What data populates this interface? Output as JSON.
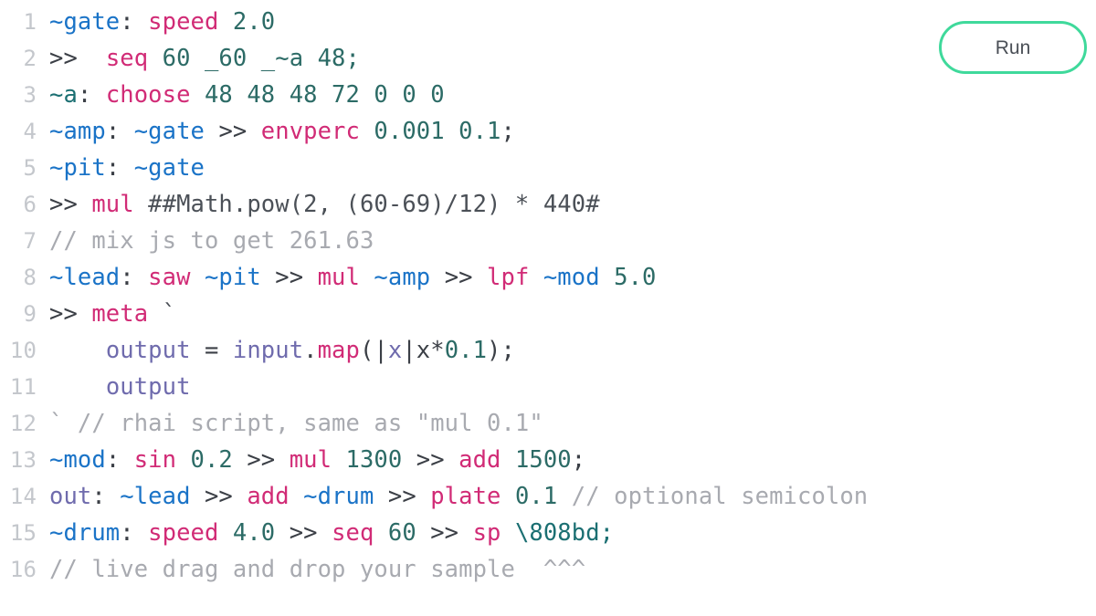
{
  "app": {
    "name": "glicol-live-coding-editor",
    "background": "#ffffff"
  },
  "colors": {
    "accent": "#3fd99b",
    "definition": "#1a73c7",
    "definition_alt": "#1b6f72",
    "output_keyword": "#6f6bad",
    "variable": "#1a73c7",
    "function": "#d12b76",
    "number": "#2c6b66",
    "string": "#1b6f72",
    "comment": "#a8aab0",
    "operator": "#3b3f46",
    "plain_text": "#4b5057",
    "line_number": "#c4c7cc",
    "run_button_text": "#4a4f56"
  },
  "toolbar": {
    "run_label": "Run"
  },
  "editor": {
    "language": "glicol",
    "first_line_number": 1,
    "last_line_number": 16,
    "lines": [
      {
        "n": "1",
        "text": "~gate: speed 2.0",
        "tokens": [
          {
            "t": "~gate",
            "c": "t-def"
          },
          {
            "t": ":",
            "c": "t-punc"
          },
          {
            "t": " ",
            "c": "t-plain"
          },
          {
            "t": "speed",
            "c": "t-fn"
          },
          {
            "t": " ",
            "c": "t-plain"
          },
          {
            "t": "2.0",
            "c": "t-num"
          }
        ]
      },
      {
        "n": "2",
        "text": ">> seq 60 _60 _~a 48;",
        "tokens": [
          {
            "t": ">>",
            "c": "t-op"
          },
          {
            "t": "  ",
            "c": "t-plain"
          },
          {
            "t": "seq",
            "c": "t-fn"
          },
          {
            "t": " ",
            "c": "t-plain"
          },
          {
            "t": "60 _60 _~a 48;",
            "c": "t-num"
          }
        ]
      },
      {
        "n": "3",
        "text": "~a: choose 48 48 48 72 0 0 0",
        "tokens": [
          {
            "t": "~a",
            "c": "t-defalt"
          },
          {
            "t": ":",
            "c": "t-punc"
          },
          {
            "t": " ",
            "c": "t-plain"
          },
          {
            "t": "choose",
            "c": "t-fn"
          },
          {
            "t": " ",
            "c": "t-plain"
          },
          {
            "t": "48 48 48 72 0 0 0",
            "c": "t-num"
          }
        ]
      },
      {
        "n": "4",
        "text": "~amp: ~gate >> envperc 0.001 0.1;",
        "tokens": [
          {
            "t": "~amp",
            "c": "t-def"
          },
          {
            "t": ":",
            "c": "t-punc"
          },
          {
            "t": " ",
            "c": "t-plain"
          },
          {
            "t": "~gate",
            "c": "t-var"
          },
          {
            "t": " ",
            "c": "t-plain"
          },
          {
            "t": ">>",
            "c": "t-op"
          },
          {
            "t": " ",
            "c": "t-plain"
          },
          {
            "t": "envperc",
            "c": "t-fn"
          },
          {
            "t": " ",
            "c": "t-plain"
          },
          {
            "t": "0.001 0.1",
            "c": "t-num"
          },
          {
            "t": ";",
            "c": "t-punc"
          }
        ]
      },
      {
        "n": "5",
        "text": "~pit: ~gate",
        "tokens": [
          {
            "t": "~pit",
            "c": "t-def"
          },
          {
            "t": ":",
            "c": "t-punc"
          },
          {
            "t": " ",
            "c": "t-plain"
          },
          {
            "t": "~gate",
            "c": "t-var"
          }
        ]
      },
      {
        "n": "6",
        "text": ">> mul ##Math.pow(2, (60-69)/12) * 440#",
        "tokens": [
          {
            "t": ">>",
            "c": "t-op"
          },
          {
            "t": " ",
            "c": "t-plain"
          },
          {
            "t": "mul",
            "c": "t-fn"
          },
          {
            "t": " ",
            "c": "t-plain"
          },
          {
            "t": "##Math.pow(2, (60-69)/12) * 440#",
            "c": "t-plain"
          }
        ]
      },
      {
        "n": "7",
        "text": "// mix js to get 261.63",
        "tokens": [
          {
            "t": "// mix js to get 261.63",
            "c": "t-comment"
          }
        ]
      },
      {
        "n": "8",
        "text": "~lead: saw ~pit >> mul ~amp >> lpf ~mod 5.0",
        "tokens": [
          {
            "t": "~lead",
            "c": "t-def"
          },
          {
            "t": ":",
            "c": "t-punc"
          },
          {
            "t": " ",
            "c": "t-plain"
          },
          {
            "t": "saw",
            "c": "t-fn"
          },
          {
            "t": " ",
            "c": "t-plain"
          },
          {
            "t": "~pit",
            "c": "t-var"
          },
          {
            "t": " ",
            "c": "t-plain"
          },
          {
            "t": ">>",
            "c": "t-op"
          },
          {
            "t": " ",
            "c": "t-plain"
          },
          {
            "t": "mul",
            "c": "t-fn"
          },
          {
            "t": " ",
            "c": "t-plain"
          },
          {
            "t": "~amp",
            "c": "t-var"
          },
          {
            "t": " ",
            "c": "t-plain"
          },
          {
            "t": ">>",
            "c": "t-op"
          },
          {
            "t": " ",
            "c": "t-plain"
          },
          {
            "t": "lpf",
            "c": "t-fn"
          },
          {
            "t": " ",
            "c": "t-plain"
          },
          {
            "t": "~mod",
            "c": "t-var"
          },
          {
            "t": " ",
            "c": "t-plain"
          },
          {
            "t": "5.0",
            "c": "t-num"
          }
        ]
      },
      {
        "n": "9",
        "text": ">> meta `",
        "tokens": [
          {
            "t": ">>",
            "c": "t-op"
          },
          {
            "t": " ",
            "c": "t-plain"
          },
          {
            "t": "meta",
            "c": "t-fn"
          },
          {
            "t": " ",
            "c": "t-plain"
          },
          {
            "t": "`",
            "c": "t-plain"
          }
        ]
      },
      {
        "n": "10",
        "text": "   output = input.map(|x|x*0.1);",
        "tokens": [
          {
            "t": "    ",
            "c": "t-plain"
          },
          {
            "t": "output",
            "c": "t-ident"
          },
          {
            "t": " ",
            "c": "t-plain"
          },
          {
            "t": "=",
            "c": "t-punc"
          },
          {
            "t": " ",
            "c": "t-plain"
          },
          {
            "t": "input",
            "c": "t-ident"
          },
          {
            "t": ".",
            "c": "t-punc"
          },
          {
            "t": "map",
            "c": "t-fn"
          },
          {
            "t": "(",
            "c": "t-punc"
          },
          {
            "t": "|",
            "c": "t-punc"
          },
          {
            "t": "x",
            "c": "t-ident"
          },
          {
            "t": "|",
            "c": "t-punc"
          },
          {
            "t": "x*",
            "c": "t-punc"
          },
          {
            "t": "0.1",
            "c": "t-num"
          },
          {
            "t": ");",
            "c": "t-punc"
          }
        ]
      },
      {
        "n": "11",
        "text": "   output",
        "tokens": [
          {
            "t": "    ",
            "c": "t-plain"
          },
          {
            "t": "output",
            "c": "t-ident"
          }
        ]
      },
      {
        "n": "12",
        "text": "` // rhai script, same as \"mul 0.1\"",
        "tokens": [
          {
            "t": "`",
            "c": "t-comment"
          },
          {
            "t": " ",
            "c": "t-plain"
          },
          {
            "t": "// rhai script, same as \"mul 0.1\"",
            "c": "t-comment"
          }
        ]
      },
      {
        "n": "13",
        "text": "~mod: sin 0.2 >> mul 1300 >> add 1500;",
        "tokens": [
          {
            "t": "~mod",
            "c": "t-def"
          },
          {
            "t": ":",
            "c": "t-punc"
          },
          {
            "t": " ",
            "c": "t-plain"
          },
          {
            "t": "sin",
            "c": "t-fn"
          },
          {
            "t": " ",
            "c": "t-plain"
          },
          {
            "t": "0.2",
            "c": "t-num"
          },
          {
            "t": " ",
            "c": "t-plain"
          },
          {
            "t": ">>",
            "c": "t-op"
          },
          {
            "t": " ",
            "c": "t-plain"
          },
          {
            "t": "mul",
            "c": "t-fn"
          },
          {
            "t": " ",
            "c": "t-plain"
          },
          {
            "t": "1300",
            "c": "t-num"
          },
          {
            "t": " ",
            "c": "t-plain"
          },
          {
            "t": ">>",
            "c": "t-op"
          },
          {
            "t": " ",
            "c": "t-plain"
          },
          {
            "t": "add",
            "c": "t-fn"
          },
          {
            "t": " ",
            "c": "t-plain"
          },
          {
            "t": "1500",
            "c": "t-num"
          },
          {
            "t": ";",
            "c": "t-punc"
          }
        ]
      },
      {
        "n": "14",
        "text": "out: ~lead >> add ~drum >> plate 0.1 // optional semicolon",
        "tokens": [
          {
            "t": "out",
            "c": "t-out"
          },
          {
            "t": ":",
            "c": "t-punc"
          },
          {
            "t": " ",
            "c": "t-plain"
          },
          {
            "t": "~lead",
            "c": "t-var"
          },
          {
            "t": " ",
            "c": "t-plain"
          },
          {
            "t": ">>",
            "c": "t-op"
          },
          {
            "t": " ",
            "c": "t-plain"
          },
          {
            "t": "add",
            "c": "t-fn"
          },
          {
            "t": " ",
            "c": "t-plain"
          },
          {
            "t": "~drum",
            "c": "t-var"
          },
          {
            "t": " ",
            "c": "t-plain"
          },
          {
            "t": ">>",
            "c": "t-op"
          },
          {
            "t": " ",
            "c": "t-plain"
          },
          {
            "t": "plate",
            "c": "t-fn"
          },
          {
            "t": " ",
            "c": "t-plain"
          },
          {
            "t": "0.1",
            "c": "t-num"
          },
          {
            "t": " ",
            "c": "t-plain"
          },
          {
            "t": "// optional semicolon",
            "c": "t-comment"
          }
        ]
      },
      {
        "n": "15",
        "text": "~drum: speed 4.0 >> seq 60 >> sp \\808bd;",
        "tokens": [
          {
            "t": "~drum",
            "c": "t-def"
          },
          {
            "t": ":",
            "c": "t-punc"
          },
          {
            "t": " ",
            "c": "t-plain"
          },
          {
            "t": "speed",
            "c": "t-fn"
          },
          {
            "t": " ",
            "c": "t-plain"
          },
          {
            "t": "4.0",
            "c": "t-num"
          },
          {
            "t": " ",
            "c": "t-plain"
          },
          {
            "t": ">>",
            "c": "t-op"
          },
          {
            "t": " ",
            "c": "t-plain"
          },
          {
            "t": "seq",
            "c": "t-fn"
          },
          {
            "t": " ",
            "c": "t-plain"
          },
          {
            "t": "60",
            "c": "t-num"
          },
          {
            "t": " ",
            "c": "t-plain"
          },
          {
            "t": ">>",
            "c": "t-op"
          },
          {
            "t": " ",
            "c": "t-plain"
          },
          {
            "t": "sp",
            "c": "t-fn"
          },
          {
            "t": " ",
            "c": "t-plain"
          },
          {
            "t": "\\808bd;",
            "c": "t-str"
          }
        ]
      },
      {
        "n": "16",
        "text": "// live drag and drop your sample  ^^^",
        "tokens": [
          {
            "t": "// live drag and drop your sample  ^^^",
            "c": "t-comment"
          }
        ]
      }
    ]
  }
}
